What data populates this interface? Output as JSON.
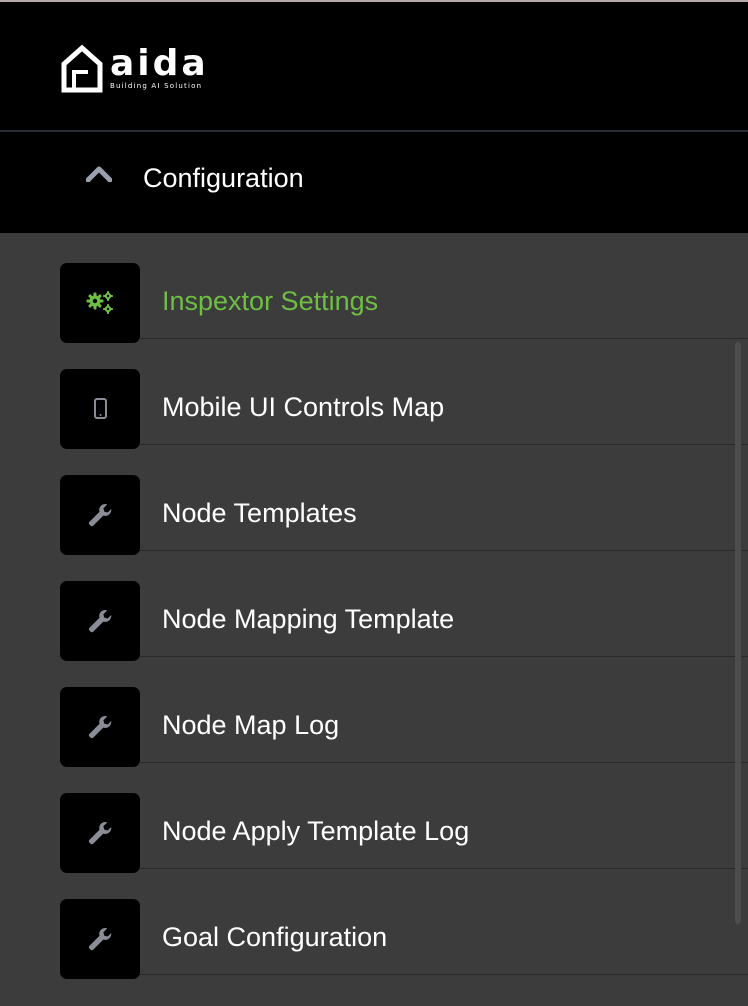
{
  "logo": {
    "brand": "aida",
    "tagline": "Building AI Solution",
    "icon": "house-logo-icon"
  },
  "section": {
    "title": "Configuration",
    "toggle_icon": "chevron-up-icon"
  },
  "menu": {
    "items": [
      {
        "label": "Inspextor Settings",
        "icon": "gears-icon",
        "active": true
      },
      {
        "label": "Mobile UI Controls Map",
        "icon": "mobile-phone-icon",
        "active": false
      },
      {
        "label": "Node Templates",
        "icon": "wrench-icon",
        "active": false
      },
      {
        "label": "Node Mapping Template",
        "icon": "wrench-icon",
        "active": false
      },
      {
        "label": "Node Map Log",
        "icon": "wrench-icon",
        "active": false
      },
      {
        "label": "Node Apply Template Log",
        "icon": "wrench-icon",
        "active": false
      },
      {
        "label": "Goal Configuration",
        "icon": "wrench-icon",
        "active": false
      }
    ]
  },
  "colors": {
    "accent": "#6ebe44",
    "icon_gray": "#8a8d96",
    "panel_bg": "#3c3c3c",
    "header_bg": "#000000"
  }
}
